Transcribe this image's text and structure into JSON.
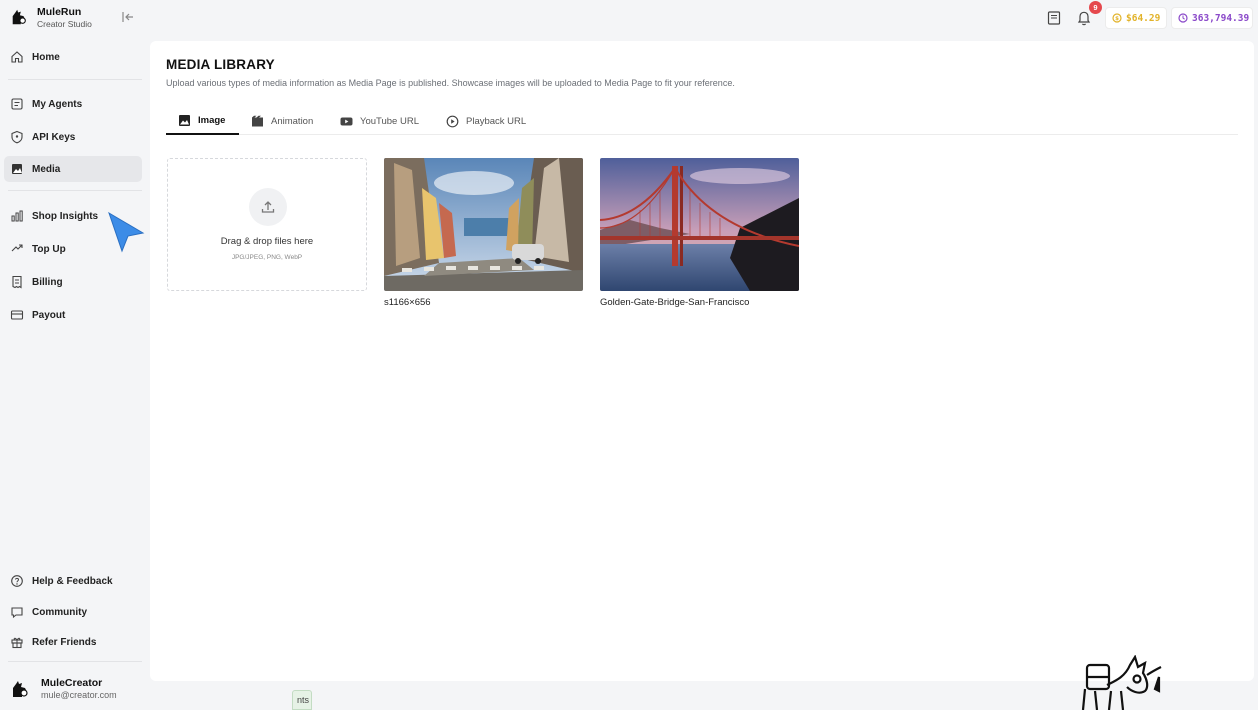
{
  "brand": {
    "name": "MuleRun",
    "subtitle": "Creator Studio"
  },
  "sidebar": {
    "items": [
      {
        "label": "Home",
        "icon": "home-icon",
        "active": false
      },
      {
        "label": "My Agents",
        "icon": "agents-icon",
        "active": false
      },
      {
        "label": "API Keys",
        "icon": "shield-icon",
        "active": false
      },
      {
        "label": "Media",
        "icon": "media-icon",
        "active": true
      },
      {
        "label": "Shop Insights",
        "icon": "bar-chart-icon",
        "active": false
      },
      {
        "label": "Top Up",
        "icon": "top-up-icon",
        "active": false
      },
      {
        "label": "Billing",
        "icon": "billing-icon",
        "active": false
      },
      {
        "label": "Payout",
        "icon": "card-icon",
        "active": false
      }
    ],
    "footer_items": [
      {
        "label": "Help & Feedback",
        "icon": "help-icon"
      },
      {
        "label": "Community",
        "icon": "chat-icon"
      },
      {
        "label": "Refer Friends",
        "icon": "gift-icon"
      }
    ]
  },
  "user": {
    "name": "MuleCreator",
    "email": "mule@creator.com"
  },
  "topbar": {
    "notification_count": "9",
    "coin_balance": "$64.29",
    "power_balance": "363,794.39",
    "colors": {
      "coin": "#e2b32a",
      "power": "#8a48c9",
      "badge": "#e5484d"
    }
  },
  "main": {
    "title": "MEDIA LIBRARY",
    "description": "Upload various types of media information as Media Page is published. Showcase images will be uploaded to Media Page to fit your reference.",
    "tabs": [
      {
        "label": "Image",
        "icon": "image-icon",
        "active": true
      },
      {
        "label": "Animation",
        "icon": "film-icon",
        "active": false
      },
      {
        "label": "YouTube URL",
        "icon": "youtube-icon",
        "active": false
      },
      {
        "label": "Playback URL",
        "icon": "play-circle-icon",
        "active": false
      }
    ],
    "upload": {
      "title": "Drag & drop files here",
      "hint": "JPG/JPEG, PNG, WebP"
    },
    "media": [
      {
        "caption": "s1166×656",
        "image": "san-francisco-street-photo"
      },
      {
        "caption": "Golden-Gate-Bridge-San-Francisco",
        "image": "golden-gate-bridge-photo"
      }
    ]
  },
  "bottom_tab_text": "nts"
}
